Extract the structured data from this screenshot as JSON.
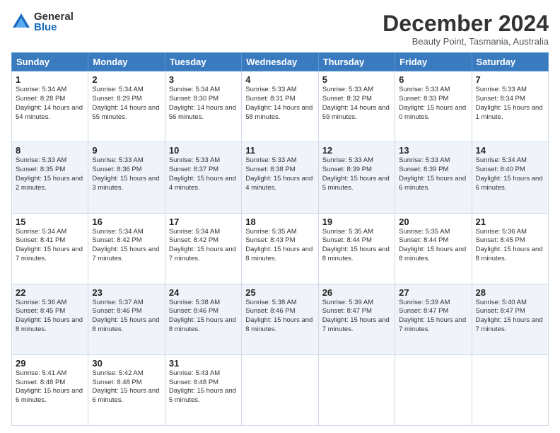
{
  "logo": {
    "general": "General",
    "blue": "Blue"
  },
  "title": "December 2024",
  "location": "Beauty Point, Tasmania, Australia",
  "headers": [
    "Sunday",
    "Monday",
    "Tuesday",
    "Wednesday",
    "Thursday",
    "Friday",
    "Saturday"
  ],
  "weeks": [
    [
      {
        "day": "1",
        "sunrise": "Sunrise: 5:34 AM",
        "sunset": "Sunset: 8:28 PM",
        "daylight": "Daylight: 14 hours and 54 minutes."
      },
      {
        "day": "2",
        "sunrise": "Sunrise: 5:34 AM",
        "sunset": "Sunset: 8:29 PM",
        "daylight": "Daylight: 14 hours and 55 minutes."
      },
      {
        "day": "3",
        "sunrise": "Sunrise: 5:34 AM",
        "sunset": "Sunset: 8:30 PM",
        "daylight": "Daylight: 14 hours and 56 minutes."
      },
      {
        "day": "4",
        "sunrise": "Sunrise: 5:33 AM",
        "sunset": "Sunset: 8:31 PM",
        "daylight": "Daylight: 14 hours and 58 minutes."
      },
      {
        "day": "5",
        "sunrise": "Sunrise: 5:33 AM",
        "sunset": "Sunset: 8:32 PM",
        "daylight": "Daylight: 14 hours and 59 minutes."
      },
      {
        "day": "6",
        "sunrise": "Sunrise: 5:33 AM",
        "sunset": "Sunset: 8:33 PM",
        "daylight": "Daylight: 15 hours and 0 minutes."
      },
      {
        "day": "7",
        "sunrise": "Sunrise: 5:33 AM",
        "sunset": "Sunset: 8:34 PM",
        "daylight": "Daylight: 15 hours and 1 minute."
      }
    ],
    [
      {
        "day": "8",
        "sunrise": "Sunrise: 5:33 AM",
        "sunset": "Sunset: 8:35 PM",
        "daylight": "Daylight: 15 hours and 2 minutes."
      },
      {
        "day": "9",
        "sunrise": "Sunrise: 5:33 AM",
        "sunset": "Sunset: 8:36 PM",
        "daylight": "Daylight: 15 hours and 3 minutes."
      },
      {
        "day": "10",
        "sunrise": "Sunrise: 5:33 AM",
        "sunset": "Sunset: 8:37 PM",
        "daylight": "Daylight: 15 hours and 4 minutes."
      },
      {
        "day": "11",
        "sunrise": "Sunrise: 5:33 AM",
        "sunset": "Sunset: 8:38 PM",
        "daylight": "Daylight: 15 hours and 4 minutes."
      },
      {
        "day": "12",
        "sunrise": "Sunrise: 5:33 AM",
        "sunset": "Sunset: 8:39 PM",
        "daylight": "Daylight: 15 hours and 5 minutes."
      },
      {
        "day": "13",
        "sunrise": "Sunrise: 5:33 AM",
        "sunset": "Sunset: 8:39 PM",
        "daylight": "Daylight: 15 hours and 6 minutes."
      },
      {
        "day": "14",
        "sunrise": "Sunrise: 5:34 AM",
        "sunset": "Sunset: 8:40 PM",
        "daylight": "Daylight: 15 hours and 6 minutes."
      }
    ],
    [
      {
        "day": "15",
        "sunrise": "Sunrise: 5:34 AM",
        "sunset": "Sunset: 8:41 PM",
        "daylight": "Daylight: 15 hours and 7 minutes."
      },
      {
        "day": "16",
        "sunrise": "Sunrise: 5:34 AM",
        "sunset": "Sunset: 8:42 PM",
        "daylight": "Daylight: 15 hours and 7 minutes."
      },
      {
        "day": "17",
        "sunrise": "Sunrise: 5:34 AM",
        "sunset": "Sunset: 8:42 PM",
        "daylight": "Daylight: 15 hours and 7 minutes."
      },
      {
        "day": "18",
        "sunrise": "Sunrise: 5:35 AM",
        "sunset": "Sunset: 8:43 PM",
        "daylight": "Daylight: 15 hours and 8 minutes."
      },
      {
        "day": "19",
        "sunrise": "Sunrise: 5:35 AM",
        "sunset": "Sunset: 8:44 PM",
        "daylight": "Daylight: 15 hours and 8 minutes."
      },
      {
        "day": "20",
        "sunrise": "Sunrise: 5:35 AM",
        "sunset": "Sunset: 8:44 PM",
        "daylight": "Daylight: 15 hours and 8 minutes."
      },
      {
        "day": "21",
        "sunrise": "Sunrise: 5:36 AM",
        "sunset": "Sunset: 8:45 PM",
        "daylight": "Daylight: 15 hours and 8 minutes."
      }
    ],
    [
      {
        "day": "22",
        "sunrise": "Sunrise: 5:36 AM",
        "sunset": "Sunset: 8:45 PM",
        "daylight": "Daylight: 15 hours and 8 minutes."
      },
      {
        "day": "23",
        "sunrise": "Sunrise: 5:37 AM",
        "sunset": "Sunset: 8:46 PM",
        "daylight": "Daylight: 15 hours and 8 minutes."
      },
      {
        "day": "24",
        "sunrise": "Sunrise: 5:38 AM",
        "sunset": "Sunset: 8:46 PM",
        "daylight": "Daylight: 15 hours and 8 minutes."
      },
      {
        "day": "25",
        "sunrise": "Sunrise: 5:38 AM",
        "sunset": "Sunset: 8:46 PM",
        "daylight": "Daylight: 15 hours and 8 minutes."
      },
      {
        "day": "26",
        "sunrise": "Sunrise: 5:39 AM",
        "sunset": "Sunset: 8:47 PM",
        "daylight": "Daylight: 15 hours and 7 minutes."
      },
      {
        "day": "27",
        "sunrise": "Sunrise: 5:39 AM",
        "sunset": "Sunset: 8:47 PM",
        "daylight": "Daylight: 15 hours and 7 minutes."
      },
      {
        "day": "28",
        "sunrise": "Sunrise: 5:40 AM",
        "sunset": "Sunset: 8:47 PM",
        "daylight": "Daylight: 15 hours and 7 minutes."
      }
    ],
    [
      {
        "day": "29",
        "sunrise": "Sunrise: 5:41 AM",
        "sunset": "Sunset: 8:48 PM",
        "daylight": "Daylight: 15 hours and 6 minutes."
      },
      {
        "day": "30",
        "sunrise": "Sunrise: 5:42 AM",
        "sunset": "Sunset: 8:48 PM",
        "daylight": "Daylight: 15 hours and 6 minutes."
      },
      {
        "day": "31",
        "sunrise": "Sunrise: 5:43 AM",
        "sunset": "Sunset: 8:48 PM",
        "daylight": "Daylight: 15 hours and 5 minutes."
      },
      null,
      null,
      null,
      null
    ]
  ]
}
